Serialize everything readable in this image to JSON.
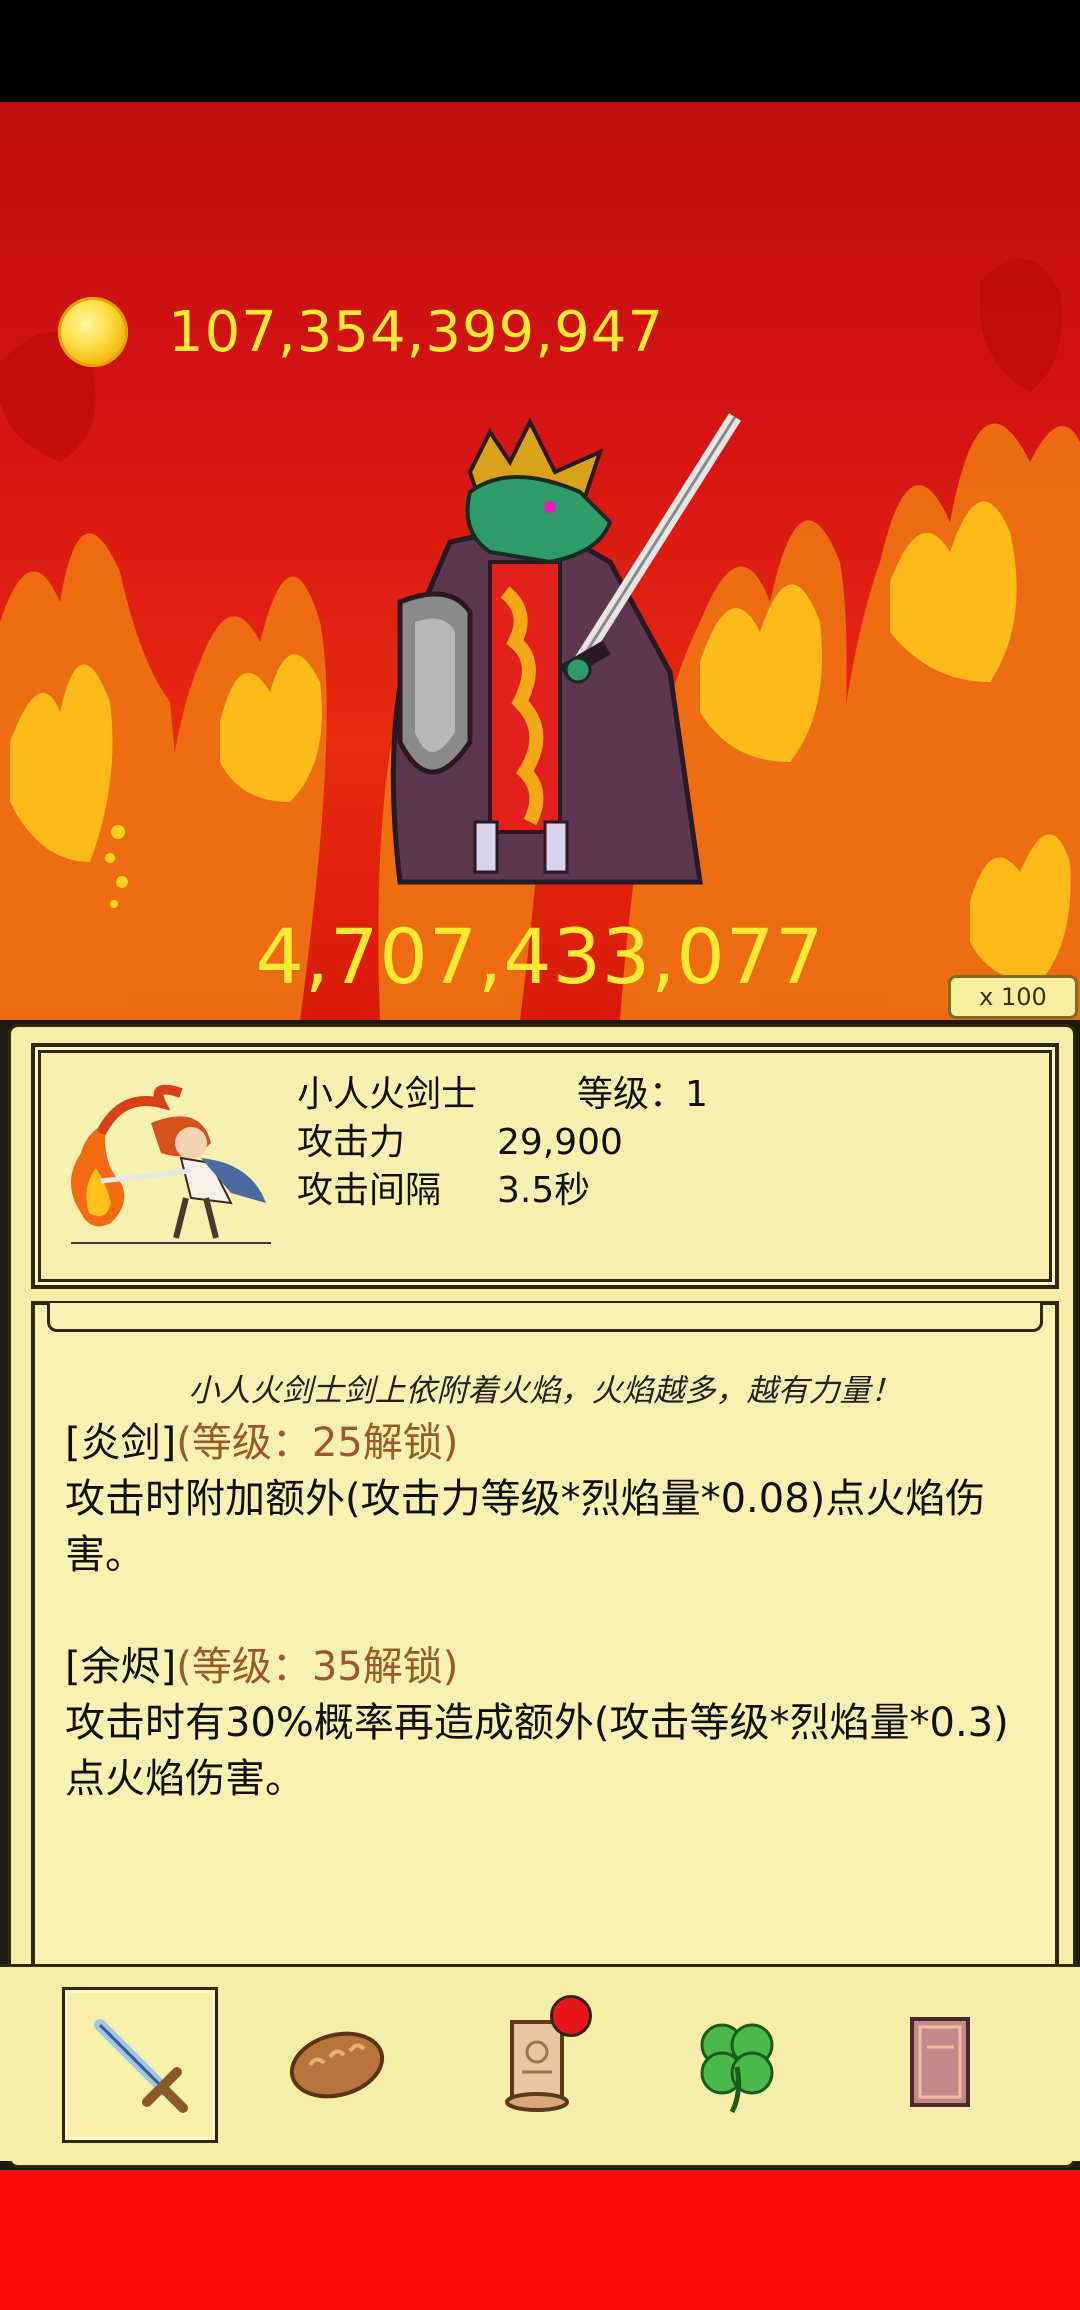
{
  "header": {
    "gold_amount": "107,354,399,947",
    "damage_value": "4,707,433,077",
    "multiplier": "x 100"
  },
  "hero": {
    "name": "小人火剑士",
    "level_label": "等级：1",
    "attack_label": "攻击力",
    "attack_value": "29,900",
    "interval_label": "攻击间隔",
    "interval_value": "3.5秒"
  },
  "description": {
    "flavor": "小人火剑士剑上依附着火焰，火焰越多，越有力量！",
    "skills": [
      {
        "name": "[炎剑]",
        "unlock_open": "(",
        "unlock": "等级：25解锁",
        "unlock_close": ")",
        "text": "攻击时附加额外(攻击力等级*烈焰量*0.08)点火焰伤害。"
      },
      {
        "name": "[余烬]",
        "unlock_open": "(",
        "unlock": "等级：35解锁",
        "unlock_close": ")",
        "text": "攻击时有30%概率再造成额外(攻击等级*烈焰量*0.3)点火焰伤害。"
      }
    ]
  },
  "tabs": [
    {
      "icon": "sword-icon",
      "selected": true,
      "badge": false
    },
    {
      "icon": "bread-icon",
      "selected": false,
      "badge": false
    },
    {
      "icon": "scroll-icon",
      "selected": false,
      "badge": true
    },
    {
      "icon": "clover-icon",
      "selected": false,
      "badge": false
    },
    {
      "icon": "book-icon",
      "selected": false,
      "badge": false
    }
  ],
  "colors": {
    "gold_text": "#ffea32",
    "unlock_text": "#9a5a24",
    "panel_bg": "#f6eea8",
    "badge": "#e8141a"
  }
}
